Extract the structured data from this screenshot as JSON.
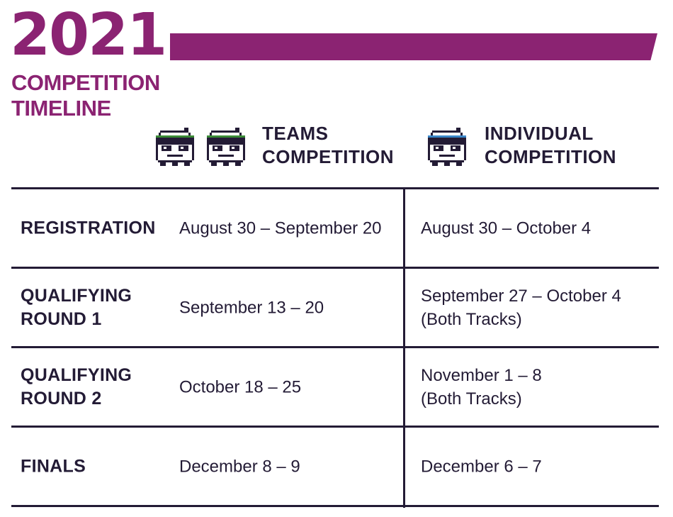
{
  "header": {
    "year": "2021",
    "subtitle_line1": "COMPETITION",
    "subtitle_line2": "TIMELINE",
    "accent_color": "#8b2372"
  },
  "columns": {
    "teams": {
      "line1": "TEAMS",
      "line2": "COMPETITION",
      "band_color": "#3a8a36"
    },
    "individual": {
      "line1": "INDIVIDUAL",
      "line2": "COMPETITION",
      "band_color": "#3a86c8"
    }
  },
  "rows": [
    {
      "label_line1": "REGISTRATION",
      "label_line2": "",
      "teams": "August 30 – September 20",
      "individual_line1": "August 30 – October 4",
      "individual_line2": ""
    },
    {
      "label_line1": "QUALIFYING",
      "label_line2": "ROUND 1",
      "teams": "September 13 – 20",
      "individual_line1": "September 27 – October 4",
      "individual_line2": "(Both Tracks)"
    },
    {
      "label_line1": "QUALIFYING",
      "label_line2": "ROUND 2",
      "teams": "October 18 – 25",
      "individual_line1": "November 1 – 8",
      "individual_line2": "(Both Tracks)"
    },
    {
      "label_line1": "FINALS",
      "label_line2": "",
      "teams": "December 8 – 9",
      "individual_line1": "December 6 – 7",
      "individual_line2": ""
    }
  ],
  "icons": {
    "teams": [
      "pixel-character-icon",
      "pixel-character-icon"
    ],
    "individual": [
      "pixel-character-icon"
    ]
  },
  "text_color": "#231b35"
}
